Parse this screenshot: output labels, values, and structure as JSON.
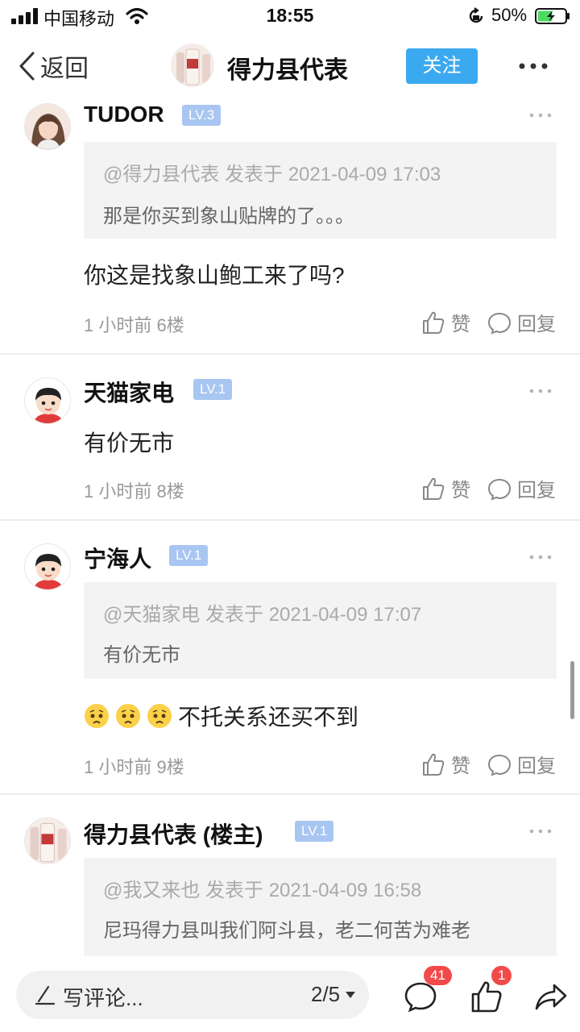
{
  "status_bar": {
    "carrier": "中国移动",
    "time": "18:55",
    "battery_percent": "50%"
  },
  "header": {
    "back_label": "返回",
    "title": "得力县代表",
    "follow_label": "关注"
  },
  "posts": [
    {
      "username": "TUDOR",
      "level": "LV.3",
      "quote": {
        "meta": "@得力县代表 发表于 2021-04-09 17:03",
        "text": "那是你买到象山贴牌的了。。。"
      },
      "content": "你这是找象山鲍工来了吗?",
      "meta": "1 小时前  6楼",
      "like_label": "赞",
      "reply_label": "回复"
    },
    {
      "username": "天猫家电",
      "level": "LV.1",
      "content": "有价无市",
      "meta": "1 小时前  8楼",
      "like_label": "赞",
      "reply_label": "回复"
    },
    {
      "username": "宁海人",
      "level": "LV.1",
      "quote": {
        "meta": "@天猫家电 发表于 2021-04-09 17:07",
        "text": "有价无市"
      },
      "content": "不托关系还买不到",
      "meta": "1 小时前  9楼",
      "like_label": "赞",
      "reply_label": "回复"
    },
    {
      "username": "得力县代表 (楼主)",
      "level": "LV.1",
      "quote": {
        "meta": "@我又来也 发表于 2021-04-09 16:58",
        "text": "尼玛得力县叫我们阿斗县，老二何苦为难老"
      }
    }
  ],
  "bottom_bar": {
    "comment_placeholder": "写评论...",
    "page_indicator": "2/5",
    "comment_count": "41",
    "like_count": "1"
  },
  "colors": {
    "accent": "#3ba9ef",
    "level_badge": "#a8c6f1",
    "badge_red": "#f24a4a",
    "quote_bg": "#f3f3f3"
  },
  "icons": [
    "signal-icon",
    "wifi-icon",
    "orientation-lock-icon",
    "battery-icon",
    "back-chevron-icon",
    "more-icon",
    "thumbs-up-icon",
    "speech-bubble-icon",
    "pen-icon",
    "share-icon",
    "worried-face-emoji"
  ]
}
